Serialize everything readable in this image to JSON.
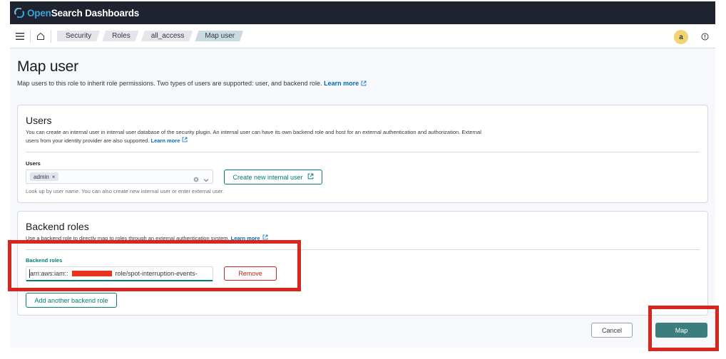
{
  "header": {
    "brand_open": "Open",
    "brand_rest": "Search Dashboards"
  },
  "breadcrumbs": [
    "Security",
    "Roles",
    "all_access",
    "Map user"
  ],
  "user_avatar": "a",
  "page": {
    "title": "Map user",
    "description": "Map users to this role to inherit role permissions. Two types of users are supported: user, and backend role.",
    "learn_more": "Learn more"
  },
  "users_panel": {
    "title": "Users",
    "description_line1": "You can create an internal user in internal user database of the security plugin. An internal user can have its own backend role and host for an external authentication and authorization. External",
    "description_line2": "users from your identity provider are also supported.",
    "learn_more": "Learn more",
    "field_label": "Users",
    "selected_token": "admin",
    "create_button": "Create new internal user",
    "help_text": "Look up by user name. You can also create new internal user or enter external user."
  },
  "backend_panel": {
    "title": "Backend roles",
    "description": "Use a backend role to directly map to roles through an external authentication system.",
    "learn_more": "Learn more",
    "field_label": "Backend roles",
    "value_prefix": "arn:aws:iam::",
    "value_suffix": "role/spot-interruption-events-",
    "remove_button": "Remove",
    "add_button": "Add another backend role"
  },
  "footer": {
    "cancel": "Cancel",
    "map": "Map"
  },
  "colors": {
    "accent": "#017d73",
    "primary_button": "#3c7d7d",
    "danger": "#bd271e",
    "annotation": "#d7261d",
    "header_bg": "#1f2330"
  },
  "icons": [
    "opensearch-logo-icon",
    "menu-icon",
    "home-icon",
    "help-icon",
    "external-link-icon",
    "clear-icon",
    "chevron-down-icon"
  ]
}
